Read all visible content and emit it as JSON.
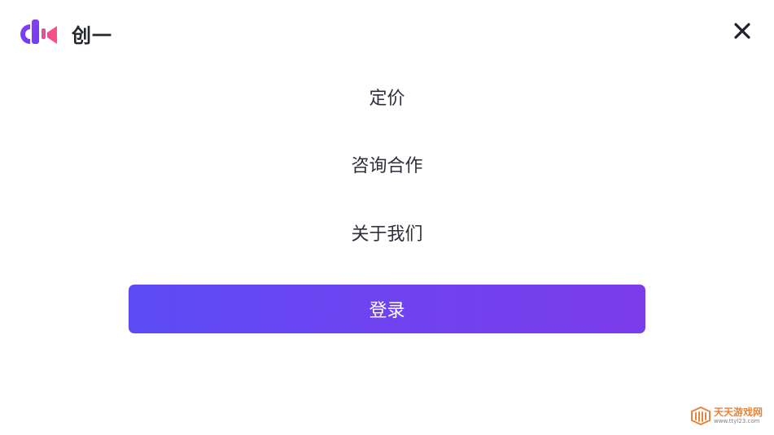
{
  "header": {
    "brand_name": "创一",
    "logo_icon": "brand-logo-icon",
    "close_icon": "close-icon"
  },
  "nav": {
    "items": [
      {
        "label": "定价"
      },
      {
        "label": "咨询合作"
      },
      {
        "label": "关于我们"
      }
    ]
  },
  "login": {
    "label": "登录"
  },
  "watermark": {
    "title": "天天游戏网",
    "url": "www.ttyl23.com"
  },
  "colors": {
    "gradient_start": "#5b4cf5",
    "gradient_end": "#7b3cea",
    "logo_purple": "#6a3ff2",
    "logo_pink": "#e64e9a",
    "text": "#2d303a"
  }
}
